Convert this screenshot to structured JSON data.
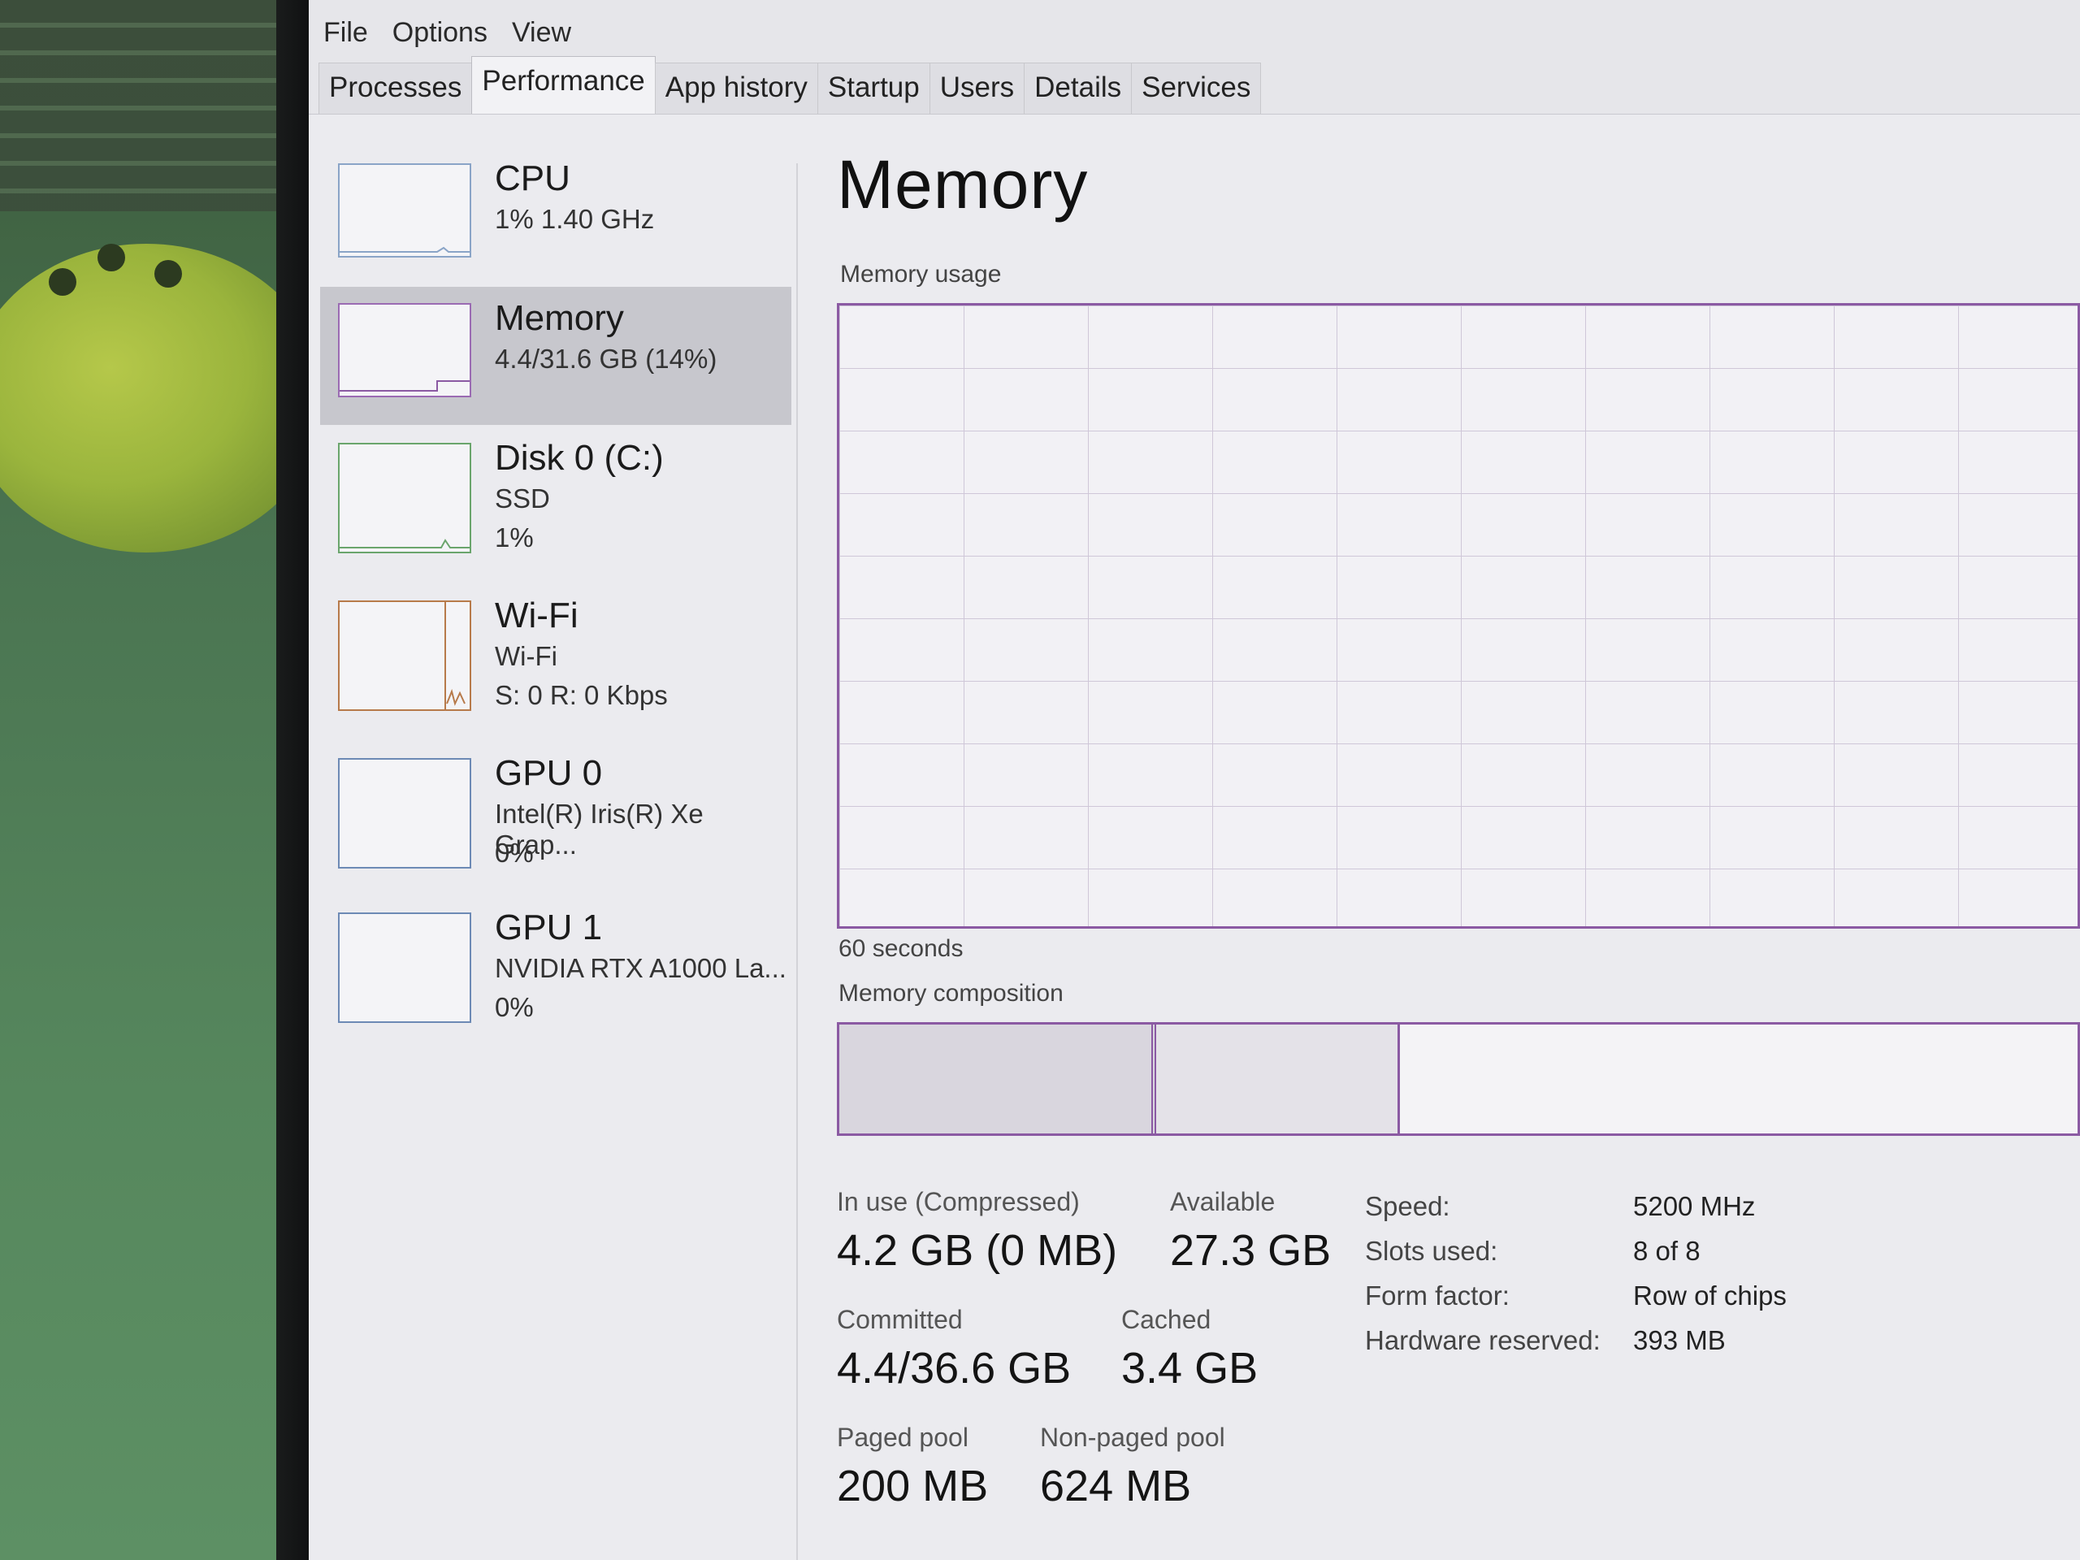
{
  "menu": [
    "File",
    "Options",
    "View"
  ],
  "tabs": [
    "Processes",
    "Performance",
    "App history",
    "Startup",
    "Users",
    "Details",
    "Services"
  ],
  "active_tab": "Performance",
  "sidebar": {
    "items": [
      {
        "title": "CPU",
        "line1": "1%  1.40 GHz",
        "line2": ""
      },
      {
        "title": "Memory",
        "line1": "4.4/31.6 GB (14%)",
        "line2": ""
      },
      {
        "title": "Disk 0 (C:)",
        "line1": "SSD",
        "line2": "1%"
      },
      {
        "title": "Wi-Fi",
        "line1": "Wi-Fi",
        "line2": "S: 0  R: 0 Kbps"
      },
      {
        "title": "GPU 0",
        "line1": "Intel(R) Iris(R) Xe Grap...",
        "line2": "0%"
      },
      {
        "title": "GPU 1",
        "line1": "NVIDIA RTX A1000 La...",
        "line2": "0%"
      }
    ],
    "selected": "Memory"
  },
  "main": {
    "title": "Memory",
    "usage_label": "Memory usage",
    "time_label": "60 seconds",
    "composition_label": "Memory composition",
    "stats": {
      "in_use_label": "In use (Compressed)",
      "in_use_value": "4.2 GB (0 MB)",
      "available_label": "Available",
      "available_value": "27.3 GB",
      "committed_label": "Committed",
      "committed_value": "4.4/36.6 GB",
      "cached_label": "Cached",
      "cached_value": "3.4 GB",
      "paged_label": "Paged pool",
      "paged_value": "200 MB",
      "nonpaged_label": "Non-paged pool",
      "nonpaged_value": "624 MB"
    },
    "details": [
      {
        "key": "Speed:",
        "value": "5200 MHz"
      },
      {
        "key": "Slots used:",
        "value": "8 of 8"
      },
      {
        "key": "Form factor:",
        "value": "Row of chips"
      },
      {
        "key": "Hardware reserved:",
        "value": "393 MB"
      }
    ]
  },
  "colors": {
    "memory_accent": "#8b5aa3",
    "cpu_accent": "#8aa4c7",
    "disk_accent": "#6aa56c",
    "wifi_accent": "#b77a4a"
  }
}
